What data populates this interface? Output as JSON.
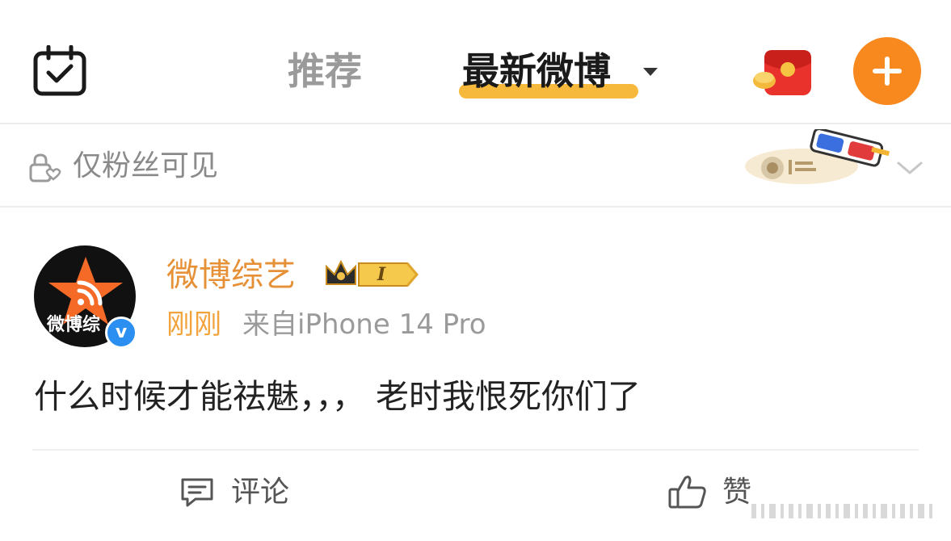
{
  "nav": {
    "tabs": [
      {
        "label": "推荐",
        "active": false
      },
      {
        "label": "最新微博",
        "active": true
      }
    ],
    "icons": [
      "calendar-check-icon",
      "red-packet-icon",
      "plus-icon"
    ],
    "accent_color": "#f7891e",
    "underline_color": "#f7b531"
  },
  "visibility": {
    "label": "仅粉丝可见",
    "icons": [
      "lock-icon",
      "3d-glasses-sticker",
      "chevron-down-icon"
    ]
  },
  "post": {
    "author": {
      "name": "微博综艺",
      "avatar_text": "微博综",
      "badge_text": "I",
      "verified_color": "#2a8ff0"
    },
    "time": "刚刚",
    "source": "来自iPhone 14 Pro",
    "text": "什么时候才能祛魅，，， 老时我恨死你们了",
    "name_color": "#e69137"
  },
  "actions": {
    "comment_label": "评论",
    "like_label": "赞"
  }
}
